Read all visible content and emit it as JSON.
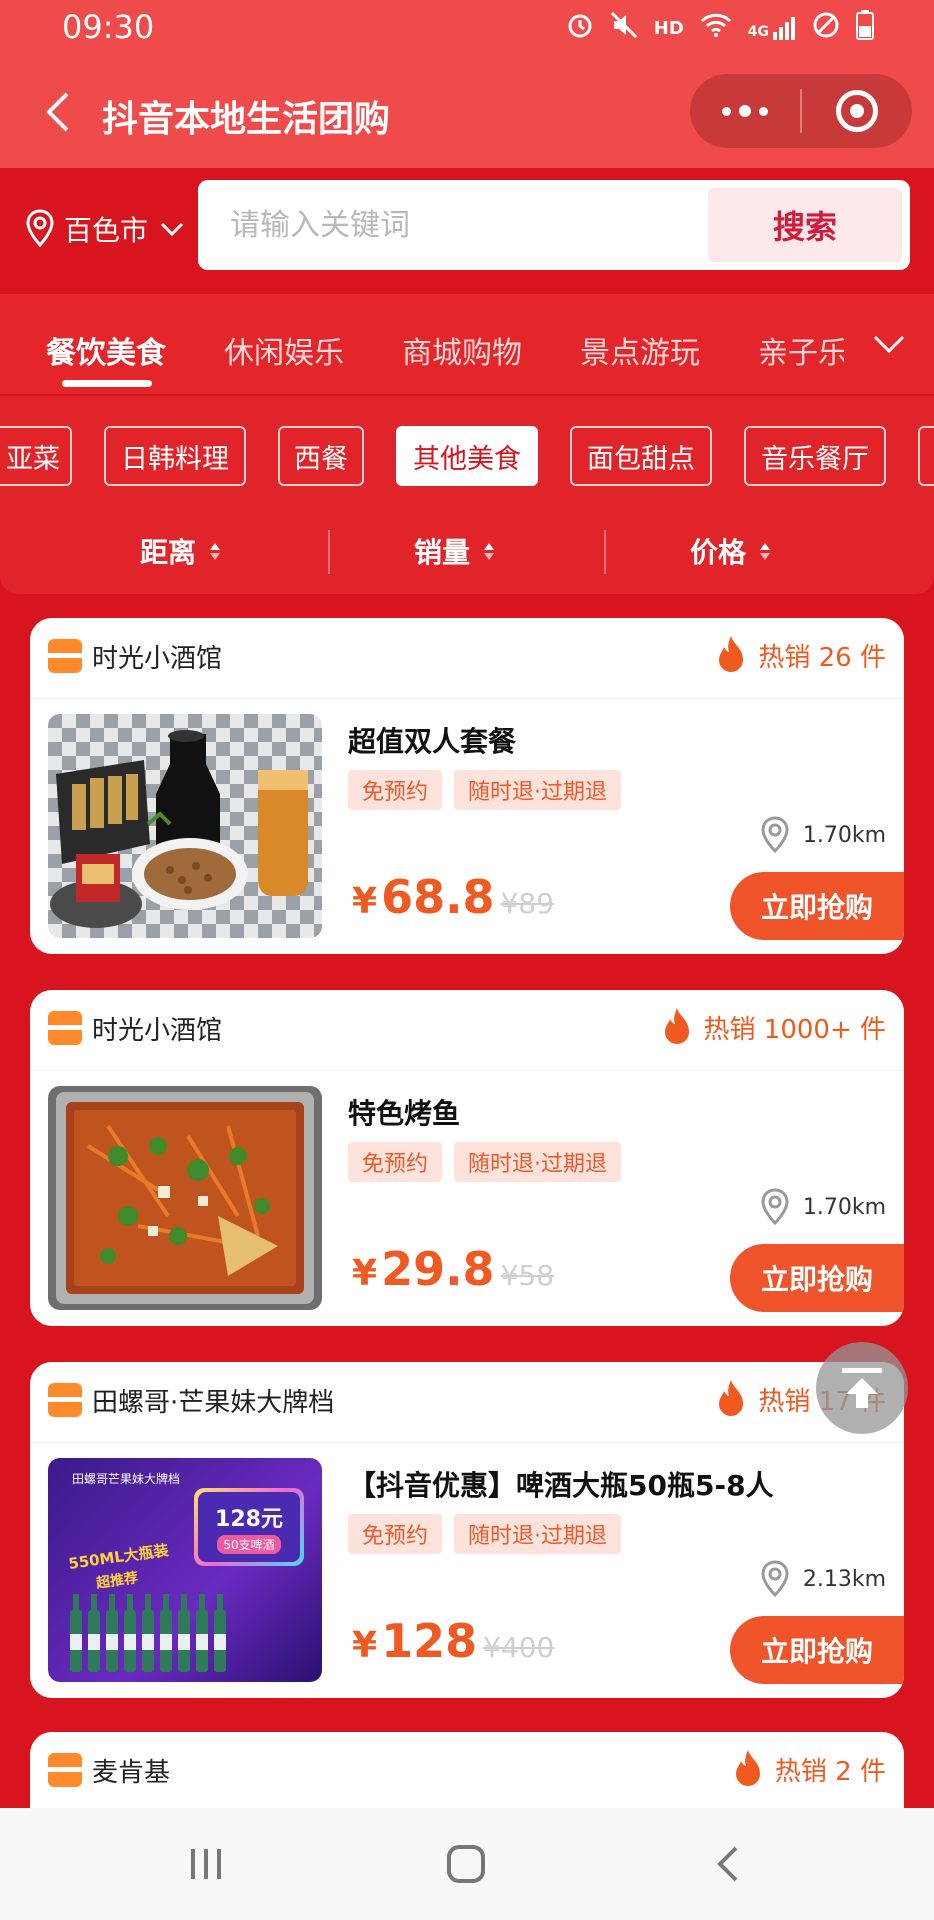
{
  "status_bar": {
    "time": "09:30",
    "icons": [
      "alarm-icon",
      "mute-icon",
      "hd-label",
      "wifi-icon",
      "4g-signal-icon",
      "no-disturb-icon",
      "battery-icon"
    ],
    "hd_label": "HD",
    "network_label": "4G"
  },
  "nav": {
    "title": "抖音本地生活团购"
  },
  "location": {
    "city": "百色市"
  },
  "search": {
    "placeholder": "请输入关键词",
    "button_label": "搜索"
  },
  "category_tabs": [
    {
      "label": "餐饮美食",
      "active": true
    },
    {
      "label": "休闲娱乐",
      "active": false
    },
    {
      "label": "商城购物",
      "active": false
    },
    {
      "label": "景点游玩",
      "active": false
    },
    {
      "label": "亲子乐",
      "active": false
    }
  ],
  "sub_chips": [
    {
      "label": "亚菜",
      "active": false
    },
    {
      "label": "日韩料理",
      "active": false
    },
    {
      "label": "西餐",
      "active": false
    },
    {
      "label": "其他美食",
      "active": true
    },
    {
      "label": "面包甜点",
      "active": false
    },
    {
      "label": "音乐餐厅",
      "active": false
    }
  ],
  "sort": {
    "distance": "距离",
    "sales": "销量",
    "price": "价格"
  },
  "products": [
    {
      "shop": "时光小酒馆",
      "hot": "热销 26 件",
      "title": "超值双人套餐",
      "tags": [
        "免预约",
        "随时退·过期退"
      ],
      "distance": "1.70km",
      "currency": "¥",
      "price": "68.8",
      "original_price": "¥89",
      "buy_label": "立即抢购"
    },
    {
      "shop": "时光小酒馆",
      "hot": "热销 1000+ 件",
      "title": "特色烤鱼",
      "tags": [
        "免预约",
        "随时退·过期退"
      ],
      "distance": "1.70km",
      "currency": "¥",
      "price": "29.8",
      "original_price": "¥58",
      "buy_label": "立即抢购"
    },
    {
      "shop": "田螺哥·芒果妹大牌档",
      "hot": "热销 17 件",
      "title": "【抖音优惠】啤酒大瓶50瓶5-8人",
      "tags": [
        "免预约",
        "随时退·过期退"
      ],
      "distance": "2.13km",
      "currency": "¥",
      "price": "128",
      "original_price": "¥400",
      "buy_label": "立即抢购",
      "poster": {
        "brand": "田螺哥芒果妹大牌档",
        "badge_price": "128元",
        "badge_sub": "50支啤酒",
        "slogan": "550ML大瓶装",
        "slogan2": "超推荐"
      }
    },
    {
      "shop": "麦肯基",
      "hot": "热销 2 件"
    }
  ],
  "colors": {
    "brand_red": "#d8141e",
    "title_bar": "#f04b4b",
    "price_orange": "#ef5a22",
    "buy_button": "#f0542a"
  }
}
